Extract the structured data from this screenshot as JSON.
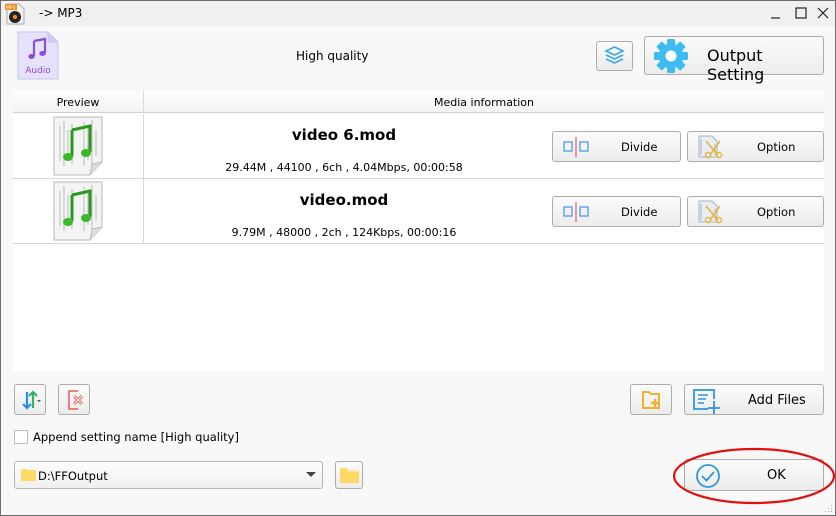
{
  "window": {
    "title": "-> MP3",
    "controls": {
      "minimize": "_",
      "maximize": "□",
      "close": "×"
    }
  },
  "header": {
    "format_badge": "Audio",
    "preset_name": "High quality",
    "output_setting_label": "Output Setting"
  },
  "list": {
    "columns": {
      "preview": "Preview",
      "media_info": "Media information"
    },
    "rows": [
      {
        "filename": "video 6.mod",
        "info": "29.44M , 44100 , 6ch , 4.04Mbps, 00:00:58",
        "divide_label": "Divide",
        "option_label": "Option"
      },
      {
        "filename": "video.mod",
        "info": "9.79M , 48000 , 2ch , 124Kbps, 00:00:16",
        "divide_label": "Divide",
        "option_label": "Option"
      }
    ]
  },
  "footer": {
    "add_files_label": "Add Files",
    "append_setting": {
      "label": "Append setting name [High quality]",
      "checked": false
    },
    "output_path": "D:\\FFOutput",
    "ok_label": "OK"
  },
  "colors": {
    "accent_blue": "#3aa7e8",
    "annotation_red": "#e01010",
    "folder_yellow": "#ffd966",
    "audio_purple": "#8a4fd8"
  }
}
